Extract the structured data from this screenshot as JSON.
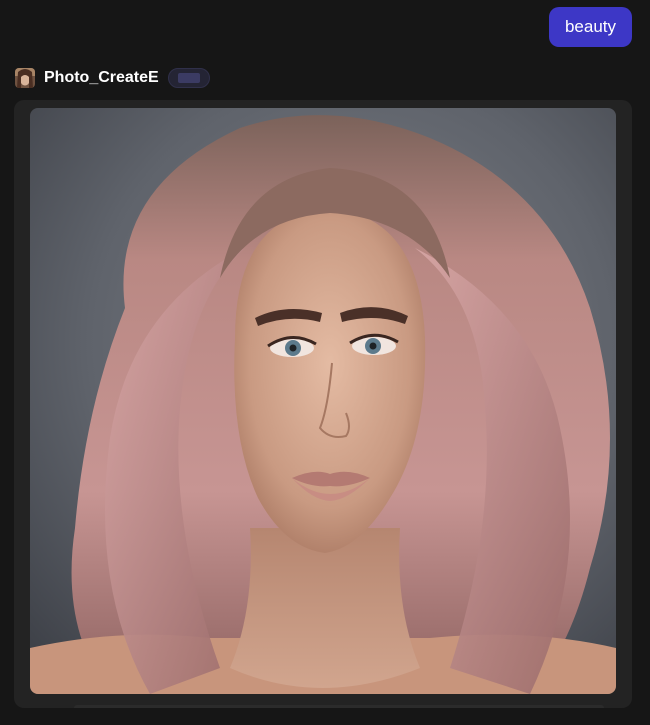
{
  "conversation": {
    "user_message": "beauty",
    "bot": {
      "name": "Photo_CreateE",
      "avatar_icon": "portrait-avatar-icon"
    },
    "generated_image": {
      "description_icon": "generated-portrait-image"
    }
  },
  "colors": {
    "background": "#161616",
    "user_bubble": "#3d37c6",
    "card": "#232323",
    "badge": "#242434"
  }
}
